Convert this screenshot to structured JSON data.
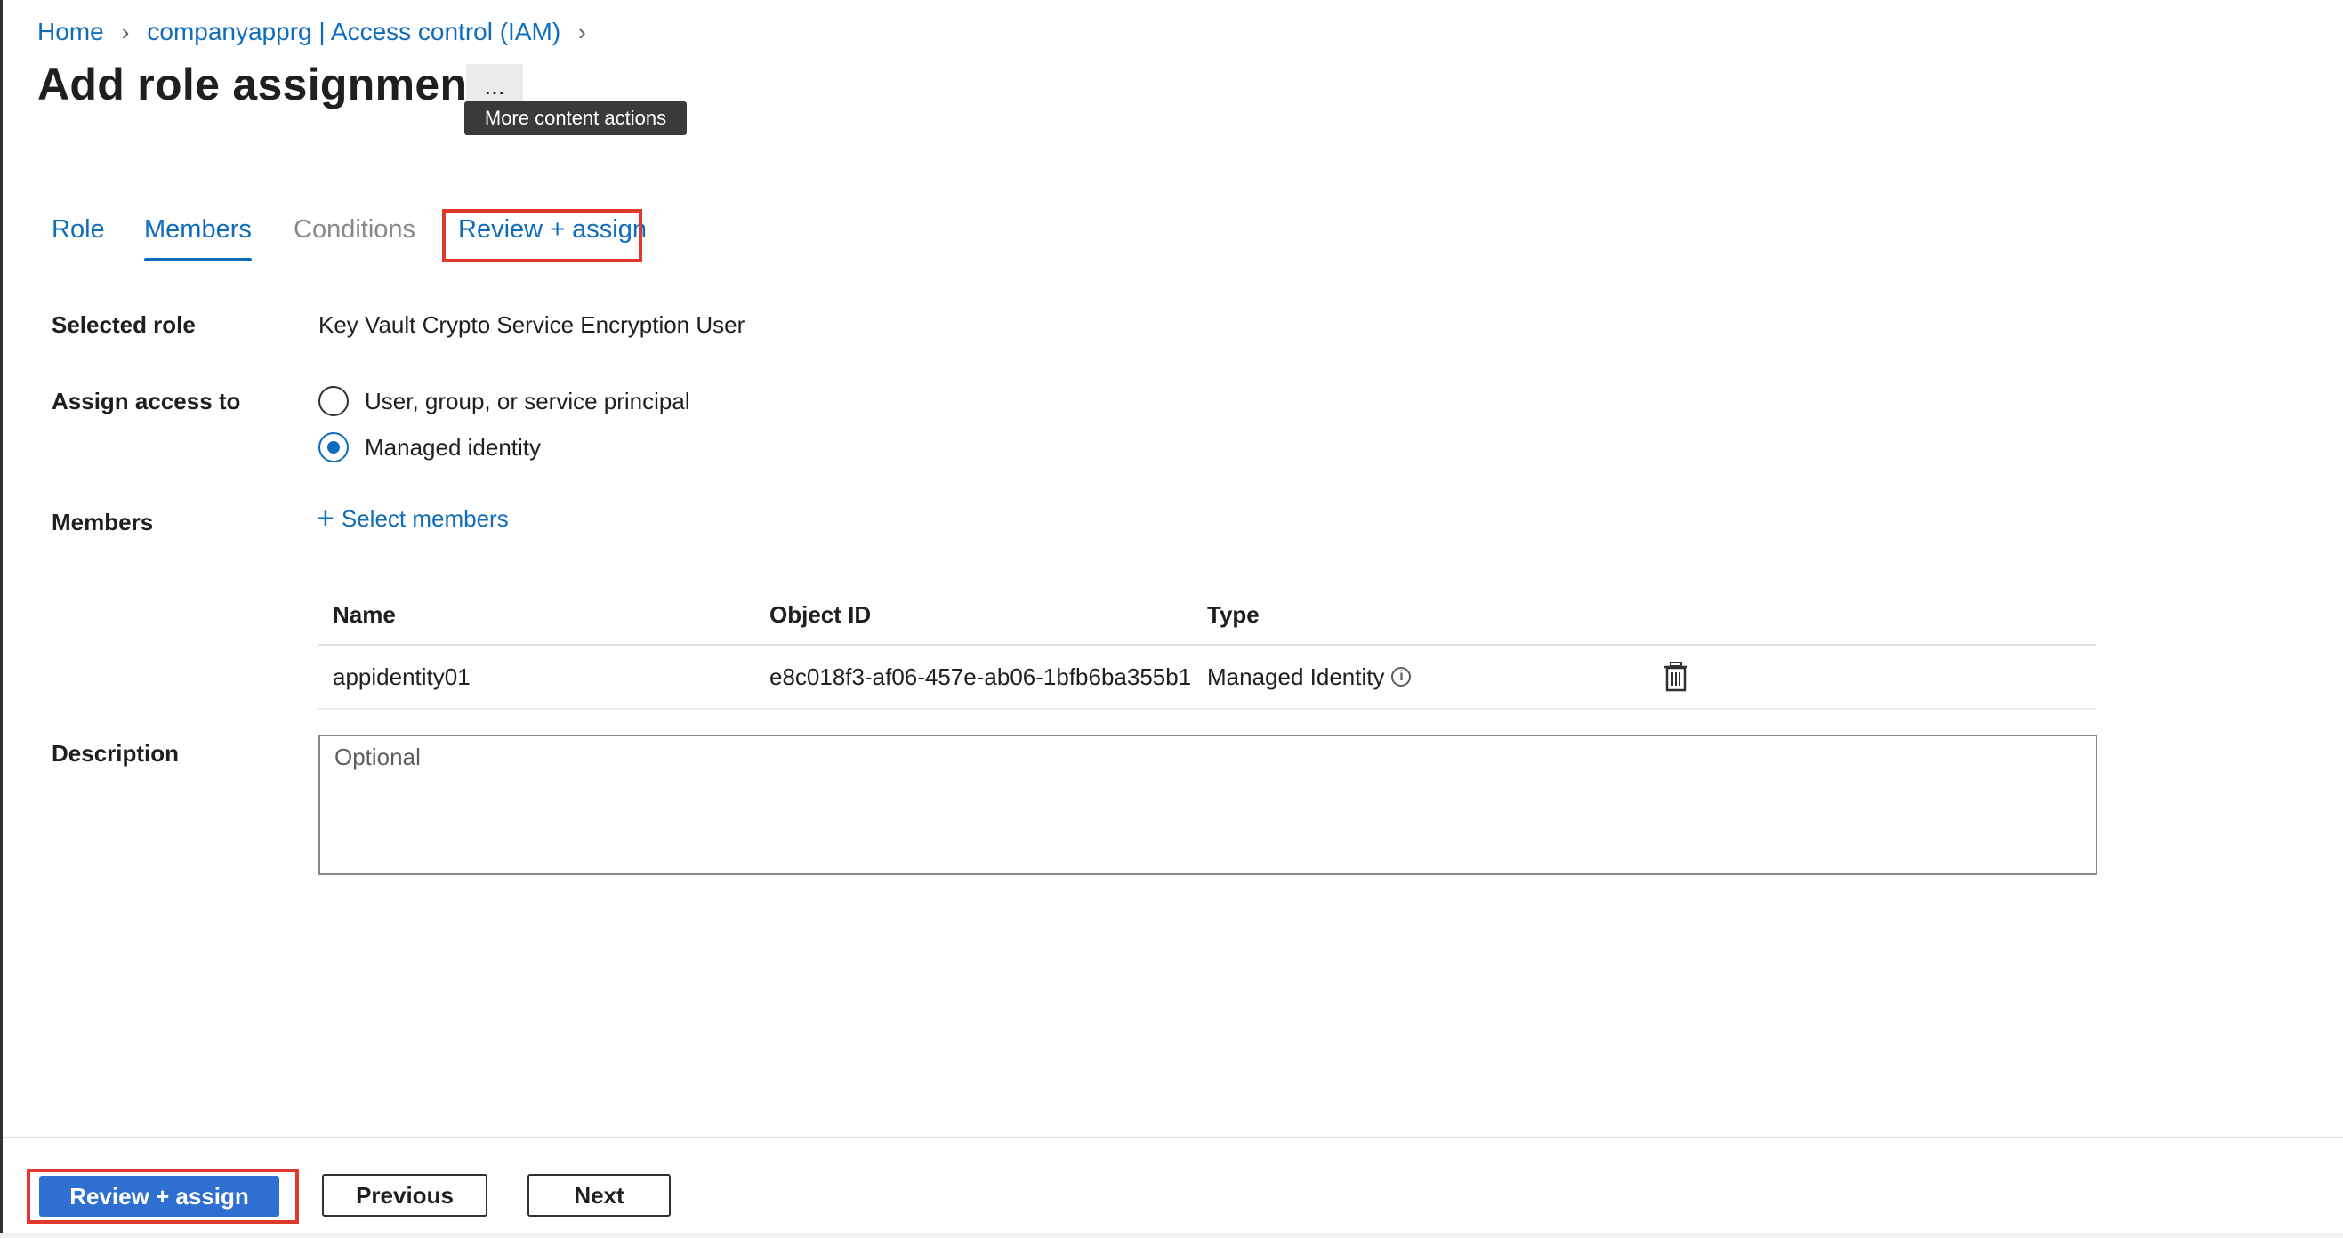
{
  "breadcrumb": {
    "home": "Home",
    "resource": "companyapprg | Access control (IAM)"
  },
  "page": {
    "title": "Add role assignment",
    "more_label": "...",
    "tooltip": "More content actions"
  },
  "tabs": [
    {
      "label": "Role"
    },
    {
      "label": "Members"
    },
    {
      "label": "Conditions"
    },
    {
      "label": "Review + assign"
    }
  ],
  "form": {
    "selected_role_label": "Selected role",
    "selected_role_value": "Key Vault Crypto Service Encryption User",
    "assign_access_label": "Assign access to",
    "assign_options": [
      {
        "label": "User, group, or service principal",
        "checked": false
      },
      {
        "label": "Managed identity",
        "checked": true
      }
    ],
    "members_label": "Members",
    "select_members": "Select members",
    "description_label": "Description",
    "description_placeholder": "Optional"
  },
  "members_table": {
    "headers": [
      "Name",
      "Object ID",
      "Type"
    ],
    "rows": [
      {
        "name": "appidentity01",
        "object_id": "e8c018f3-af06-457e-ab06-1bfb6ba355b1",
        "type": "Managed Identity"
      }
    ]
  },
  "footer": {
    "review_assign": "Review + assign",
    "previous": "Previous",
    "next": "Next"
  },
  "colors": {
    "accent": "#0f6cbd",
    "primary_button": "#2f6fd1",
    "highlight": "#e0392b"
  }
}
